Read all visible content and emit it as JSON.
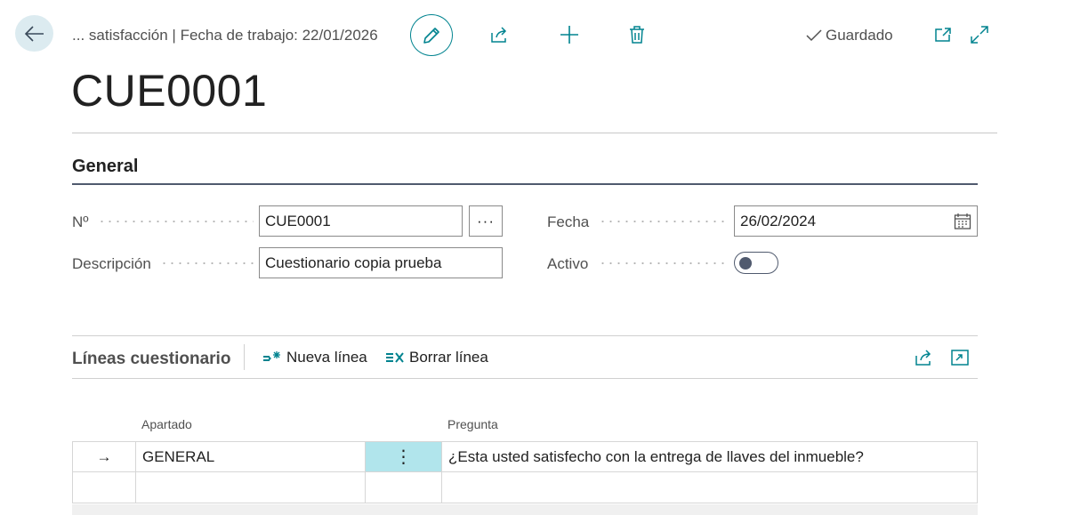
{
  "header": {
    "breadcrumb": "... satisfacción | Fecha de trabajo: 22/01/2026",
    "saved_label": "Guardado"
  },
  "page": {
    "title": "CUE0001"
  },
  "general": {
    "section_title": "General",
    "no_label": "Nº",
    "no_value": "CUE0001",
    "ellipsis_label": "···",
    "descripcion_label": "Descripción",
    "descripcion_value": "Cuestionario copia prueba",
    "fecha_label": "Fecha",
    "fecha_value": "26/02/2024",
    "activo_label": "Activo",
    "activo_on": false
  },
  "lines": {
    "title": "Líneas cuestionario",
    "new_line_label": "Nueva línea",
    "delete_line_label": "Borrar línea",
    "columns": {
      "apartado": "Apartado",
      "pregunta": "Pregunta"
    },
    "rows": [
      {
        "indicator": "→",
        "apartado": "GENERAL",
        "menu": "⋮",
        "pregunta": "¿Esta usted satisfecho con la entrega de llaves del inmueble?"
      },
      {
        "indicator": "",
        "apartado": "",
        "menu": "",
        "pregunta": ""
      }
    ]
  },
  "colors": {
    "accent": "#00838f",
    "back_button_bg": "#dcebf0",
    "selected_cell_bg": "#b1e5ec",
    "section_rule": "#505a6e"
  },
  "icons": [
    "back-arrow-icon",
    "pencil-icon",
    "share-icon",
    "plus-icon",
    "trash-icon",
    "check-icon",
    "open-new-window-icon",
    "expand-icon",
    "calendar-icon",
    "new-line-icon",
    "delete-line-icon",
    "share-icon",
    "expand-panel-icon"
  ]
}
